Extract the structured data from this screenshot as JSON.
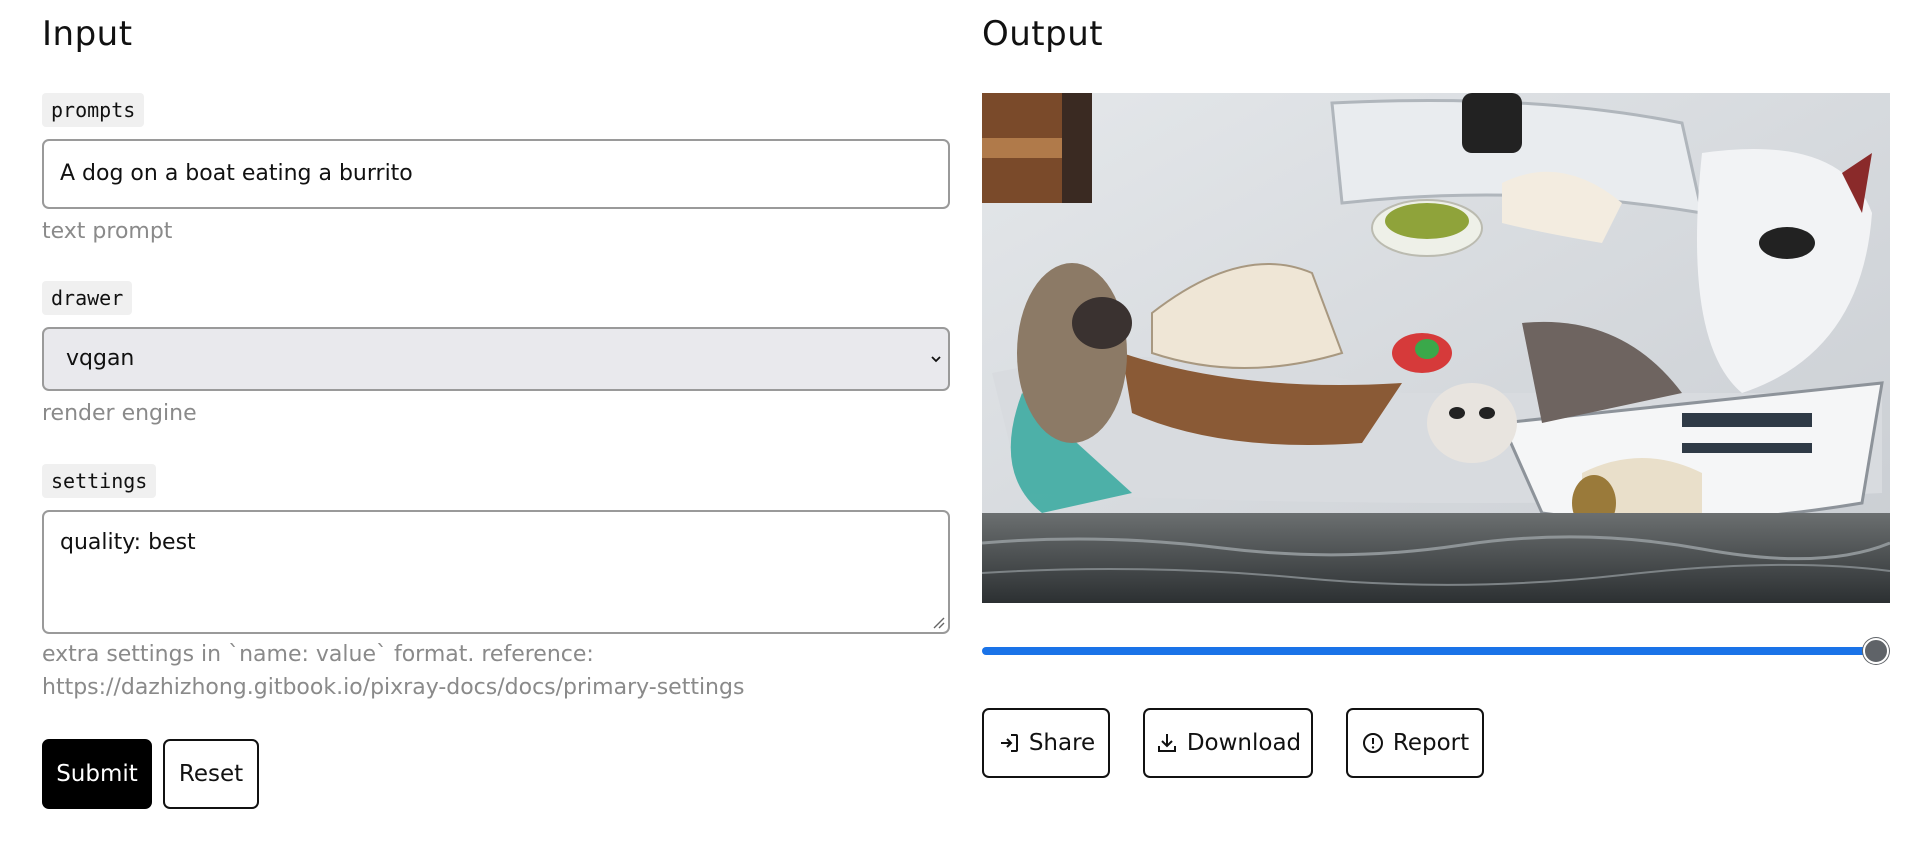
{
  "input": {
    "title": "Input",
    "prompts": {
      "label": "prompts",
      "value": "A dog on a boat eating a burrito",
      "hint": "text prompt"
    },
    "drawer": {
      "label": "drawer",
      "value": "vqgan",
      "hint": "render engine"
    },
    "settings": {
      "label": "settings",
      "value": "quality: best",
      "hint": "extra settings in `name: value` format. reference: https://dazhizhong.gitbook.io/pixray-docs/docs/primary-settings"
    },
    "submit_label": "Submit",
    "reset_label": "Reset"
  },
  "output": {
    "title": "Output",
    "slider_level": 1.0,
    "share_label": "Share",
    "download_label": "Download",
    "report_label": "Report"
  },
  "colors": {
    "slider_accent": "#1a73e8",
    "primary_button": "#000000"
  }
}
